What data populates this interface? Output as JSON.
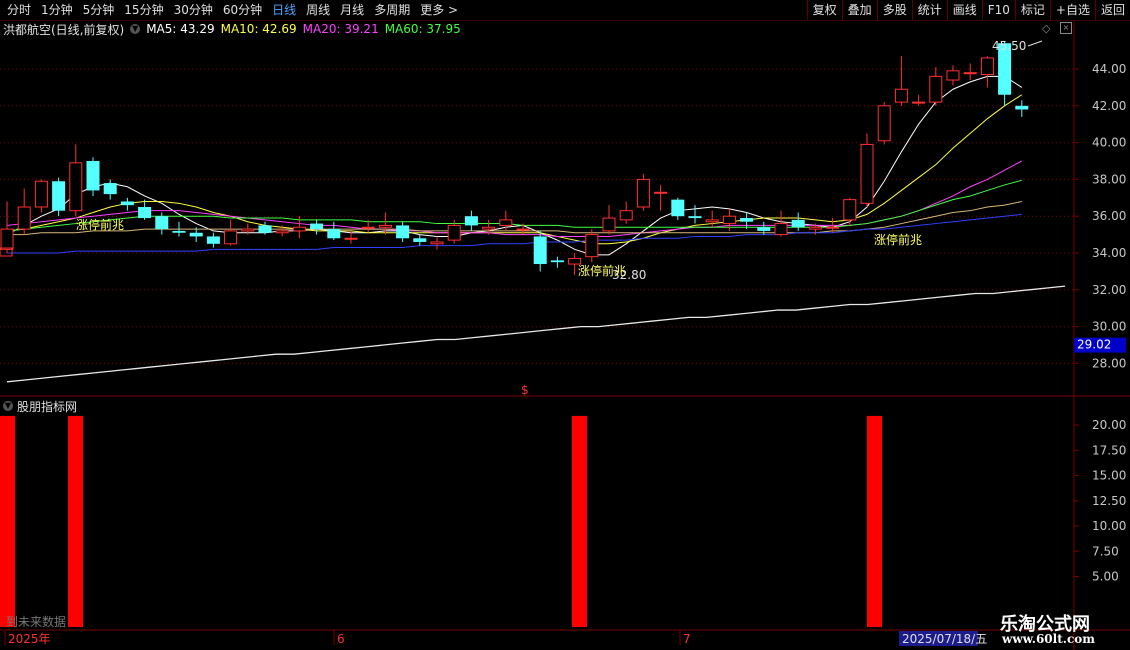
{
  "toolbar": {
    "periods": [
      "分时",
      "1分钟",
      "5分钟",
      "15分钟",
      "30分钟",
      "60分钟",
      "日线",
      "周线",
      "月线",
      "多周期",
      "更多 >"
    ],
    "active_period": "日线",
    "right_buttons": [
      "复权",
      "叠加",
      "多股",
      "统计",
      "画线",
      "F10",
      "标记",
      "+自选",
      "返回"
    ]
  },
  "info": {
    "stock": "洪都航空(日线,前复权)",
    "ma5": "MA5: 43.29",
    "ma10": "MA10: 42.69",
    "ma20": "MA20: 39.21",
    "ma60": "MA60: 37.95"
  },
  "colors": {
    "up": "#ff3030",
    "down": "#54ffff",
    "ma5": "#ffffff",
    "ma10": "#ffff40",
    "ma20": "#ff40ff",
    "ma60": "#40ff40",
    "ma120": "#d8b878",
    "ma250": "#3040ff",
    "long": "#e8e8e8",
    "signal_text": "#ffff60",
    "bar": "#ff0000",
    "grid": "#7a0000"
  },
  "price_axis": {
    "labels": [
      "44.00",
      "42.00",
      "40.00",
      "38.00",
      "36.00",
      "34.00",
      "32.00",
      "30.00",
      "28.00"
    ],
    "current": "29.02"
  },
  "annotations": {
    "high": "45.50",
    "low": "32.80",
    "dollar": "$"
  },
  "signals": [
    "涨停前兆",
    "涨停前兆",
    "涨停前兆"
  ],
  "indicator": {
    "title": "股朋指标网",
    "axis": [
      "20.00",
      "17.50",
      "15.00",
      "12.50",
      "10.00",
      "7.50",
      "5.00"
    ]
  },
  "date_axis": {
    "labels": [
      "2025年",
      "6",
      "7"
    ],
    "current_date": "2025/07/18/五"
  },
  "footer": {
    "future_note": "到未来数据"
  },
  "watermark": {
    "brand": "乐淘公式网",
    "site": "www.60lt.com"
  },
  "chart_data": {
    "type": "candlestick",
    "title": "洪都航空(日线,前复权)",
    "ylim": [
      27,
      46
    ],
    "candles": [
      {
        "o": 34.2,
        "c": 35.3,
        "h": 36.8,
        "l": 34.0
      },
      {
        "o": 35.3,
        "c": 36.5,
        "h": 37.5,
        "l": 35.0
      },
      {
        "o": 36.5,
        "c": 37.9,
        "h": 38.0,
        "l": 36.2
      },
      {
        "o": 37.9,
        "c": 36.3,
        "h": 38.1,
        "l": 36.0
      },
      {
        "o": 36.3,
        "c": 38.9,
        "h": 39.9,
        "l": 36.0
      },
      {
        "o": 39.0,
        "c": 37.4,
        "h": 39.2,
        "l": 37.1
      },
      {
        "o": 37.8,
        "c": 37.2,
        "h": 38.0,
        "l": 36.9
      },
      {
        "o": 36.8,
        "c": 36.6,
        "h": 37.0,
        "l": 36.3
      },
      {
        "o": 36.5,
        "c": 35.9,
        "h": 36.9,
        "l": 35.8
      },
      {
        "o": 36.0,
        "c": 35.3,
        "h": 36.2,
        "l": 35.0
      },
      {
        "o": 35.2,
        "c": 35.1,
        "h": 35.7,
        "l": 34.9
      },
      {
        "o": 35.1,
        "c": 34.9,
        "h": 35.4,
        "l": 34.6
      },
      {
        "o": 34.9,
        "c": 34.5,
        "h": 35.1,
        "l": 34.3
      },
      {
        "o": 34.5,
        "c": 35.2,
        "h": 35.8,
        "l": 34.4
      },
      {
        "o": 35.2,
        "c": 35.3,
        "h": 35.6,
        "l": 35.0
      },
      {
        "o": 35.5,
        "c": 35.1,
        "h": 35.7,
        "l": 35.0
      },
      {
        "o": 35.1,
        "c": 35.2,
        "h": 35.5,
        "l": 34.9
      },
      {
        "o": 35.2,
        "c": 35.4,
        "h": 36.0,
        "l": 34.8
      },
      {
        "o": 35.6,
        "c": 35.3,
        "h": 35.8,
        "l": 35.0
      },
      {
        "o": 35.3,
        "c": 34.8,
        "h": 35.7,
        "l": 34.7
      },
      {
        "o": 34.8,
        "c": 34.8,
        "h": 35.2,
        "l": 34.5
      },
      {
        "o": 35.4,
        "c": 35.4,
        "h": 35.8,
        "l": 35.1
      },
      {
        "o": 35.4,
        "c": 35.5,
        "h": 36.2,
        "l": 35.0
      },
      {
        "o": 35.5,
        "c": 34.8,
        "h": 35.7,
        "l": 34.6
      },
      {
        "o": 34.8,
        "c": 34.6,
        "h": 35.0,
        "l": 34.4
      },
      {
        "o": 34.5,
        "c": 34.6,
        "h": 34.9,
        "l": 34.2
      },
      {
        "o": 34.7,
        "c": 35.5,
        "h": 35.8,
        "l": 34.5
      },
      {
        "o": 36.0,
        "c": 35.5,
        "h": 36.3,
        "l": 35.2
      },
      {
        "o": 35.3,
        "c": 35.4,
        "h": 35.8,
        "l": 35.0
      },
      {
        "o": 35.5,
        "c": 35.8,
        "h": 36.3,
        "l": 35.2
      },
      {
        "o": 35.3,
        "c": 35.3,
        "h": 35.6,
        "l": 35.0
      },
      {
        "o": 34.9,
        "c": 33.4,
        "h": 35.2,
        "l": 33.0
      },
      {
        "o": 33.6,
        "c": 33.5,
        "h": 33.8,
        "l": 33.2
      },
      {
        "o": 33.4,
        "c": 33.7,
        "h": 34.0,
        "l": 32.8
      },
      {
        "o": 33.8,
        "c": 35.0,
        "h": 35.3,
        "l": 33.5
      },
      {
        "o": 35.2,
        "c": 35.9,
        "h": 36.6,
        "l": 35.0
      },
      {
        "o": 35.8,
        "c": 36.3,
        "h": 36.8,
        "l": 35.6
      },
      {
        "o": 36.5,
        "c": 38.0,
        "h": 38.3,
        "l": 36.3
      },
      {
        "o": 37.3,
        "c": 37.3,
        "h": 37.7,
        "l": 36.3
      },
      {
        "o": 36.9,
        "c": 36.0,
        "h": 37.0,
        "l": 35.8
      },
      {
        "o": 36.0,
        "c": 35.9,
        "h": 36.6,
        "l": 35.6
      },
      {
        "o": 35.7,
        "c": 35.8,
        "h": 36.3,
        "l": 35.4
      },
      {
        "o": 35.6,
        "c": 36.0,
        "h": 36.4,
        "l": 35.2
      },
      {
        "o": 35.9,
        "c": 35.7,
        "h": 36.2,
        "l": 35.3
      },
      {
        "o": 35.4,
        "c": 35.2,
        "h": 35.7,
        "l": 35.0
      },
      {
        "o": 35.0,
        "c": 35.6,
        "h": 36.3,
        "l": 34.9
      },
      {
        "o": 35.8,
        "c": 35.4,
        "h": 36.2,
        "l": 35.2
      },
      {
        "o": 35.3,
        "c": 35.4,
        "h": 35.6,
        "l": 35.0
      },
      {
        "o": 35.4,
        "c": 35.4,
        "h": 35.9,
        "l": 35.1
      },
      {
        "o": 35.8,
        "c": 36.9,
        "h": 37.0,
        "l": 35.5
      },
      {
        "o": 36.7,
        "c": 39.9,
        "h": 40.5,
        "l": 36.5
      },
      {
        "o": 40.1,
        "c": 42.0,
        "h": 42.2,
        "l": 39.9
      },
      {
        "o": 42.2,
        "c": 42.9,
        "h": 44.7,
        "l": 42.0
      },
      {
        "o": 42.2,
        "c": 42.2,
        "h": 42.6,
        "l": 42.0
      },
      {
        "o": 42.2,
        "c": 43.6,
        "h": 44.1,
        "l": 42.0
      },
      {
        "o": 43.4,
        "c": 43.9,
        "h": 44.2,
        "l": 43.1
      },
      {
        "o": 43.8,
        "c": 43.8,
        "h": 44.3,
        "l": 43.4
      },
      {
        "o": 43.7,
        "c": 44.6,
        "h": 44.7,
        "l": 43.0
      },
      {
        "o": 45.4,
        "c": 42.6,
        "h": 45.5,
        "l": 42.0
      },
      {
        "o": 42.0,
        "c": 41.8,
        "h": 42.3,
        "l": 41.4
      }
    ],
    "ma_series": [
      {
        "name": "MA5",
        "values": [
          35.0,
          35.5,
          36.0,
          36.4,
          37.2,
          37.6,
          37.8,
          37.6,
          37.1,
          36.7,
          36.1,
          35.6,
          35.2,
          35.1,
          35.1,
          35.1,
          35.2,
          35.2,
          35.3,
          35.2,
          35.1,
          35.1,
          35.2,
          35.2,
          35.0,
          34.9,
          34.9,
          35.1,
          35.2,
          35.4,
          35.5,
          35.1,
          34.7,
          34.2,
          33.9,
          33.9,
          34.5,
          35.2,
          35.9,
          36.3,
          36.4,
          36.5,
          36.4,
          36.2,
          35.9,
          35.7,
          35.6,
          35.5,
          35.4,
          35.7,
          36.5,
          37.9,
          39.5,
          41.0,
          42.2,
          42.9,
          43.3,
          43.6,
          43.6,
          43.0
        ]
      },
      {
        "name": "MA10",
        "values": [
          35.2,
          35.3,
          35.5,
          35.7,
          35.9,
          36.2,
          36.5,
          36.7,
          36.8,
          36.8,
          36.7,
          36.5,
          36.2,
          36.0,
          35.7,
          35.5,
          35.4,
          35.3,
          35.2,
          35.2,
          35.2,
          35.1,
          35.1,
          35.1,
          35.1,
          35.1,
          35.1,
          35.1,
          35.1,
          35.1,
          35.1,
          35.1,
          34.9,
          34.7,
          34.5,
          34.5,
          34.6,
          34.8,
          35.1,
          35.3,
          35.5,
          35.6,
          35.7,
          35.8,
          35.9,
          35.9,
          35.9,
          35.8,
          35.7,
          35.8,
          36.1,
          36.7,
          37.4,
          38.1,
          38.8,
          39.7,
          40.5,
          41.3,
          42.0,
          42.6
        ]
      },
      {
        "name": "MA20",
        "values": [
          35.5,
          35.6,
          35.7,
          35.8,
          35.9,
          36.0,
          36.1,
          36.2,
          36.3,
          36.3,
          36.3,
          36.2,
          36.1,
          36.0,
          35.9,
          35.8,
          35.7,
          35.6,
          35.5,
          35.5,
          35.4,
          35.3,
          35.3,
          35.2,
          35.2,
          35.1,
          35.1,
          35.1,
          35.1,
          35.0,
          35.0,
          35.0,
          34.9,
          34.9,
          34.9,
          34.9,
          35.0,
          35.1,
          35.2,
          35.3,
          35.4,
          35.4,
          35.5,
          35.5,
          35.5,
          35.5,
          35.5,
          35.5,
          35.5,
          35.5,
          35.6,
          35.8,
          36.0,
          36.3,
          36.7,
          37.1,
          37.6,
          38.0,
          38.5,
          39.0
        ]
      },
      {
        "name": "MA60",
        "values": [
          35.2,
          35.3,
          35.4,
          35.5,
          35.6,
          35.7,
          35.8,
          35.9,
          36.0,
          36.0,
          36.0,
          36.0,
          36.0,
          35.9,
          35.9,
          35.9,
          35.9,
          35.8,
          35.8,
          35.8,
          35.8,
          35.7,
          35.7,
          35.7,
          35.7,
          35.6,
          35.6,
          35.6,
          35.6,
          35.6,
          35.5,
          35.5,
          35.5,
          35.4,
          35.4,
          35.4,
          35.4,
          35.4,
          35.4,
          35.4,
          35.4,
          35.4,
          35.4,
          35.4,
          35.4,
          35.4,
          35.4,
          35.4,
          35.4,
          35.5,
          35.6,
          35.8,
          36.0,
          36.3,
          36.6,
          36.9,
          37.1,
          37.4,
          37.7,
          37.95
        ]
      },
      {
        "name": "MA120",
        "values": [
          35.0,
          35.0,
          35.1,
          35.1,
          35.1,
          35.2,
          35.2,
          35.2,
          35.3,
          35.3,
          35.3,
          35.3,
          35.3,
          35.3,
          35.3,
          35.3,
          35.3,
          35.3,
          35.3,
          35.3,
          35.3,
          35.3,
          35.3,
          35.3,
          35.2,
          35.2,
          35.2,
          35.2,
          35.2,
          35.2,
          35.2,
          35.2,
          35.2,
          35.1,
          35.1,
          35.1,
          35.1,
          35.1,
          35.1,
          35.1,
          35.1,
          35.1,
          35.1,
          35.1,
          35.1,
          35.1,
          35.1,
          35.1,
          35.2,
          35.2,
          35.3,
          35.4,
          35.6,
          35.8,
          36.0,
          36.2,
          36.3,
          36.5,
          36.6,
          36.8
        ]
      },
      {
        "name": "MA250",
        "values": [
          34.0,
          34.0,
          34.0,
          34.0,
          34.1,
          34.1,
          34.1,
          34.1,
          34.1,
          34.1,
          34.1,
          34.1,
          34.2,
          34.2,
          34.2,
          34.2,
          34.2,
          34.2,
          34.2,
          34.3,
          34.3,
          34.3,
          34.3,
          34.3,
          34.4,
          34.4,
          34.4,
          34.4,
          34.5,
          34.5,
          34.5,
          34.6,
          34.6,
          34.6,
          34.7,
          34.7,
          34.7,
          34.8,
          34.8,
          34.8,
          34.9,
          34.9,
          34.9,
          35.0,
          35.0,
          35.0,
          35.1,
          35.1,
          35.1,
          35.2,
          35.3,
          35.3,
          35.4,
          35.5,
          35.6,
          35.7,
          35.8,
          35.9,
          36.0,
          36.1
        ]
      },
      {
        "name": "LONG",
        "values": [
          27.0,
          27.1,
          27.2,
          27.3,
          27.4,
          27.5,
          27.6,
          27.7,
          27.8,
          27.9,
          28.0,
          28.1,
          28.2,
          28.3,
          28.4,
          28.5,
          28.5,
          28.6,
          28.7,
          28.8,
          28.9,
          29.0,
          29.1,
          29.2,
          29.3,
          29.3,
          29.4,
          29.5,
          29.6,
          29.7,
          29.8,
          29.9,
          30.0,
          30.0,
          30.1,
          30.2,
          30.3,
          30.4,
          30.5,
          30.5,
          30.6,
          30.7,
          30.8,
          30.9,
          30.9,
          31.0,
          31.1,
          31.2,
          31.2,
          31.3,
          31.4,
          31.5,
          31.6,
          31.7,
          31.8,
          31.8,
          31.9,
          32.0,
          32.1,
          32.2
        ]
      }
    ],
    "indicator_bars": [
      {
        "index": 0,
        "value": 20.9
      },
      {
        "index": 4,
        "value": 20.9
      },
      {
        "index": 33,
        "value": 20.9
      },
      {
        "index": 50,
        "value": 20.9
      }
    ],
    "indicator_ylim": [
      0,
      22.5
    ]
  }
}
